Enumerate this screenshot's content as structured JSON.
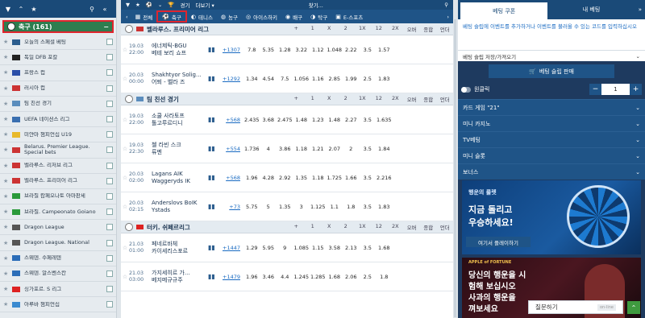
{
  "left": {
    "sport": {
      "label": "축구 (161)"
    },
    "leagues": [
      {
        "name": "오늘의 스페셜 베팅",
        "flag": "#2b5d8e"
      },
      {
        "name": "독일 DFB 포칼",
        "flag": "#222"
      },
      {
        "name": "프랑스 컵",
        "flag": "#2b4fa8"
      },
      {
        "name": "러시아 컵",
        "flag": "#c33"
      },
      {
        "name": "팀 친선 경기",
        "flag": "#5b8dbd"
      },
      {
        "name": "UEFA 네이션스 리그",
        "flag": "#3a6fb0"
      },
      {
        "name": "미얀마 챔피언십 U19",
        "flag": "#e8b92b"
      },
      {
        "name": "Belarus. Premier League. Special bets",
        "flag": "#c33"
      },
      {
        "name": "벨라루스. 리저브 리그",
        "flag": "#c33"
      },
      {
        "name": "벨라루스. 프리미어 리그",
        "flag": "#c33"
      },
      {
        "name": "브라질 캄페오나토 아마판세",
        "flag": "#2a9a3a"
      },
      {
        "name": "브라질. Campeonato Goiano",
        "flag": "#2a9a3a"
      },
      {
        "name": "Dragon League",
        "flag": "#555"
      },
      {
        "name": "Dragon League. National",
        "flag": "#555"
      },
      {
        "name": "스웨덴. 수페레텐",
        "flag": "#2b6db8"
      },
      {
        "name": "스웨덴. 알스벤스칸",
        "flag": "#2b6db8"
      },
      {
        "name": "싱가포르. S 리그",
        "flag": "#d22"
      },
      {
        "name": "아루바 챔피언십",
        "flag": "#3a8ad0"
      }
    ]
  },
  "mid": {
    "top": {
      "live": "경기",
      "more": "더보기 ▾",
      "search": "찾기..."
    },
    "tabs": [
      {
        "icon": "grid-icon",
        "label": "전체",
        "active": false
      },
      {
        "icon": "ball-icon",
        "label": "축구",
        "active": true
      },
      {
        "icon": "tennis-icon",
        "label": "테니스",
        "active": false
      },
      {
        "icon": "basketball-icon",
        "label": "농구",
        "active": false
      },
      {
        "icon": "hockey-icon",
        "label": "아이스하키",
        "active": false
      },
      {
        "icon": "volleyball-icon",
        "label": "배구",
        "active": false
      },
      {
        "icon": "pingpong-icon",
        "label": "탁구",
        "active": false
      },
      {
        "icon": "esports-icon",
        "label": "E-스포츠",
        "active": false
      }
    ],
    "cols": [
      "+",
      "1",
      "X",
      "2",
      "1X",
      "12",
      "2X",
      "오버",
      "종합",
      "언더"
    ],
    "groups": [
      {
        "name": "벨라루스. 프리미어 리그",
        "flag": "#c33",
        "rows": [
          {
            "date": "19.03",
            "time": "22:00",
            "t1": "에너제틱-BGU",
            "t2": "베테 보리 쇼프",
            "more": "+1307",
            "odds": [
              "7.8",
              "5.35",
              "1.28",
              "3.22",
              "1.12",
              "1.048",
              "2.22",
              "3.5",
              "1.57"
            ]
          },
          {
            "date": "20.03",
            "time": "00:00",
            "t1": "Shakhtyor Solig...",
            "t2": "어퇴 - 벨라 즈",
            "more": "+1292",
            "odds": [
              "1.34",
              "4.54",
              "7.5",
              "1.056",
              "1.16",
              "2.85",
              "1.99",
              "2.5",
              "1.83"
            ]
          }
        ]
      },
      {
        "name": "팀 친선 경기",
        "flag": "#5b8dbd",
        "rows": [
          {
            "date": "19.03",
            "time": "22:00",
            "t1": "소쿨 사라토프",
            "t2": "톨고루르디니",
            "more": "+568",
            "odds": [
              "2.435",
              "3.68",
              "2.475",
              "1.48",
              "1.23",
              "1.48",
              "2.27",
              "3.5",
              "1.635"
            ]
          },
          {
            "date": "19.03",
            "time": "22:30",
            "t1": "첼 라빈 스크",
            "t2": "류멘",
            "more": "+554",
            "odds": [
              "1.736",
              "4",
              "3.86",
              "1.18",
              "1.21",
              "2.07",
              "2",
              "3.5",
              "1.84"
            ]
          },
          {
            "date": "20.03",
            "time": "02:00",
            "t1": "Lagans AIK",
            "t2": "Waggeryds IK",
            "more": "+568",
            "odds": [
              "1.96",
              "4.28",
              "2.92",
              "1.35",
              "1.18",
              "1.725",
              "1.66",
              "3.5",
              "2.216"
            ]
          },
          {
            "date": "20.03",
            "time": "02:15",
            "t1": "Anderslovs BoIK",
            "t2": "Ystads",
            "more": "+73",
            "odds": [
              "5.75",
              "5",
              "1.35",
              "3",
              "1.125",
              "1.1",
              "1.8",
              "3.5",
              "1.83"
            ]
          }
        ]
      },
      {
        "name": "터키. 쉬페르리그",
        "flag": "#d22",
        "rows": [
          {
            "date": "21.03",
            "time": "01:00",
            "t1": "페네르바체",
            "t2": "카이세리스포르",
            "more": "+1447",
            "odds": [
              "1.29",
              "5.95",
              "9",
              "1.085",
              "1.15",
              "3.58",
              "2.13",
              "3.5",
              "1.68"
            ]
          },
          {
            "date": "21.03",
            "time": "03:00",
            "t1": "가지세히르 가...",
            "t2": "베지메규규주",
            "more": "+1479",
            "odds": [
              "1.96",
              "3.46",
              "4.4",
              "1.245",
              "1.285",
              "1.68",
              "2.06",
              "2.5",
              "1.8"
            ]
          }
        ]
      }
    ]
  },
  "right": {
    "tabs": [
      "베팅 쿠폰",
      "내 베팅"
    ],
    "note": "베팅 슬립에 이벤트를 추가하거나 이벤트를 불러올 수 있는 코드를 입력하십시오",
    "save": "베팅 슬립 저장/가져오기",
    "sell": "베팅 슬립 판매",
    "oneclick": "원클릭",
    "stake": "1",
    "sections": [
      "카드 게임 \"21\"",
      "미니 카지노",
      "TV베팅",
      "미니 슬롯",
      "보너스"
    ],
    "promo1": {
      "title": "행운의 룰렛",
      "line1": "지금 돌리고",
      "line2": "우승하세요!",
      "btn": "여기서 플레이하기"
    },
    "promo2": {
      "logo": "APPLE of FORTUNE",
      "line1": "당신의 행운을 시",
      "line2": "험해 보십시오",
      "line3": "사과의 행운을",
      "line4": "껴보세요"
    },
    "chat": "질문하기",
    "chat_badge": "on-line"
  }
}
